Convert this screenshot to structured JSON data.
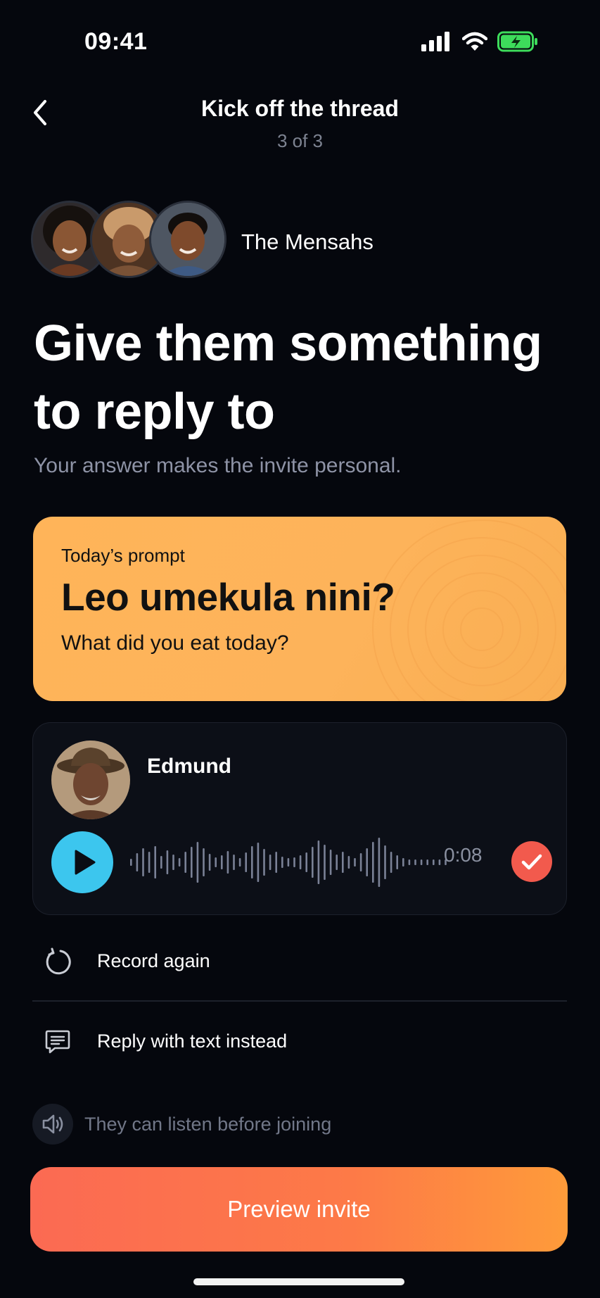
{
  "status_bar": {
    "time": "09:41"
  },
  "header": {
    "title": "Kick off the thread",
    "step": "3 of 3"
  },
  "group": {
    "name": "The Mensahs"
  },
  "headline": "Give them something to reply to",
  "subhead": "Your answer makes the invite personal.",
  "prompt": {
    "label": "Today’s prompt",
    "title": "Leo umekula nini?",
    "translation": "What did you eat today?"
  },
  "recording": {
    "name": "Edmund",
    "duration": "0:08"
  },
  "actions": {
    "record_again": "Record again",
    "reply_text": "Reply with text instead"
  },
  "listen_note": "They can listen before joining",
  "cta": {
    "label": "Preview invite"
  },
  "colors": {
    "background": "#05070d",
    "prompt_card": "#fdb35a",
    "play_button": "#3cc6ee",
    "check_button": "#f25a4d",
    "cta_start": "#fb6a53",
    "cta_end": "#fe9b3a",
    "battery": "#3ddc5b"
  },
  "icons": {
    "back": "chevron-left-icon",
    "signal": "cellular-signal-icon",
    "wifi": "wifi-icon",
    "battery": "battery-charging-icon",
    "play": "play-icon",
    "check": "check-icon",
    "record_again": "refresh-icon",
    "reply_text": "message-icon",
    "listen": "speaker-icon"
  }
}
